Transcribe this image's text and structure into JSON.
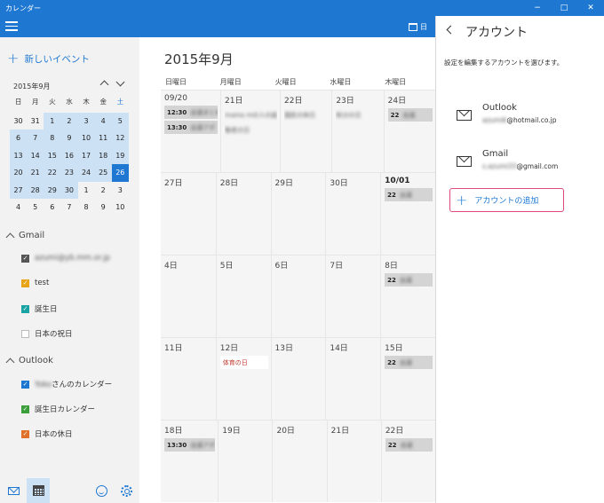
{
  "window": {
    "title": "カレンダー",
    "minimize": "−",
    "maximize": "□",
    "close": "✕"
  },
  "toolbar": {
    "today_label": "日"
  },
  "sidebar": {
    "new_event": "新しいイベント",
    "mini_month": "2015年9月",
    "dow": [
      "日",
      "月",
      "火",
      "水",
      "木",
      "金",
      "土"
    ],
    "weeks": [
      [
        "30",
        "31",
        "1",
        "2",
        "3",
        "4",
        "5"
      ],
      [
        "6",
        "7",
        "8",
        "9",
        "10",
        "11",
        "12"
      ],
      [
        "13",
        "14",
        "15",
        "16",
        "17",
        "18",
        "19"
      ],
      [
        "20",
        "21",
        "22",
        "23",
        "24",
        "25",
        "26"
      ],
      [
        "27",
        "28",
        "29",
        "30",
        "1",
        "2",
        "3"
      ],
      [
        "4",
        "5",
        "6",
        "7",
        "8",
        "9",
        "10"
      ]
    ],
    "groups": [
      {
        "name": "Gmail",
        "items": [
          {
            "label": "azumi@yb.mm.or.jp",
            "color": "#555555",
            "checked": true,
            "blurred": true
          },
          {
            "label": "test",
            "color": "#e8a317",
            "checked": true
          },
          {
            "label": "誕生日",
            "color": "#1aa3a3",
            "checked": true
          },
          {
            "label": "日本の祝日",
            "color": "#bbbbbb",
            "checked": false
          }
        ]
      },
      {
        "name": "Outlook",
        "items": [
          {
            "prefix": "Yoko",
            "label": "さんのカレンダー",
            "color": "#1e78d2",
            "checked": true
          },
          {
            "label": "誕生日カレンダー",
            "color": "#3a9e3a",
            "checked": true
          },
          {
            "label": "日本の休日",
            "color": "#e0702a",
            "checked": true
          }
        ]
      }
    ],
    "checkmark": "✓",
    "bottom_icons": [
      "mail-icon",
      "calendar-icon",
      "feedback-icon",
      "gear-icon"
    ]
  },
  "month": {
    "title": "2015年9月",
    "dow": [
      "日曜日",
      "月曜日",
      "火曜日",
      "水曜日",
      "木曜日"
    ],
    "weeks": [
      {
        "days": [
          {
            "num": "09/20",
            "events": [
              {
                "type": "grey",
                "time": "12:30",
                "text": "会議まとめ"
              },
              {
                "type": "grey",
                "time": "13:30",
                "text": "会議アポ"
              }
            ]
          },
          {
            "num": "21日",
            "events": [
              {
                "type": "text-green",
                "text": "mama mの人の誕"
              },
              {
                "type": "text-red",
                "text": "敬老の日"
              }
            ]
          },
          {
            "num": "22日",
            "events": [
              {
                "type": "text-red",
                "text": "国民の休日"
              }
            ]
          },
          {
            "num": "23日",
            "events": [
              {
                "type": "text-orange",
                "text": "秋分の日"
              }
            ]
          },
          {
            "num": "24日",
            "events": [
              {
                "type": "grey",
                "time": "22",
                "text": "会議"
              }
            ]
          }
        ]
      },
      {
        "days": [
          {
            "num": "27日",
            "events": []
          },
          {
            "num": "28日",
            "events": []
          },
          {
            "num": "29日",
            "events": []
          },
          {
            "num": "30日",
            "events": []
          },
          {
            "num": "10/01",
            "bold": true,
            "events": [
              {
                "type": "grey",
                "time": "22",
                "text": "会議"
              }
            ]
          }
        ]
      },
      {
        "days": [
          {
            "num": "4日",
            "events": []
          },
          {
            "num": "5日",
            "events": []
          },
          {
            "num": "6日",
            "events": []
          },
          {
            "num": "7日",
            "events": []
          },
          {
            "num": "8日",
            "events": [
              {
                "type": "grey",
                "time": "22",
                "text": "会議"
              }
            ]
          }
        ]
      },
      {
        "days": [
          {
            "num": "11日",
            "events": []
          },
          {
            "num": "12日",
            "events": [
              {
                "type": "white",
                "text": "体育の日"
              }
            ]
          },
          {
            "num": "13日",
            "events": []
          },
          {
            "num": "14日",
            "events": []
          },
          {
            "num": "15日",
            "events": [
              {
                "type": "grey",
                "time": "22",
                "text": "会議"
              }
            ]
          }
        ]
      },
      {
        "days": [
          {
            "num": "18日",
            "events": [
              {
                "type": "grey",
                "time": "13:30",
                "text": "会議アポ"
              }
            ]
          },
          {
            "num": "19日",
            "events": []
          },
          {
            "num": "20日",
            "events": []
          },
          {
            "num": "21日",
            "events": []
          },
          {
            "num": "22日",
            "events": [
              {
                "type": "grey",
                "time": "22",
                "text": "会議"
              }
            ]
          }
        ]
      }
    ]
  },
  "accounts_pane": {
    "title": "アカウント",
    "description": "設定を編集するアカウントを選びます。",
    "accounts": [
      {
        "name": "Outlook",
        "email_user": "azumi6",
        "email_domain": "@hotmail.co.jp"
      },
      {
        "name": "Gmail",
        "email_user": "s.azumi33",
        "email_domain": "@gmail.com"
      }
    ],
    "add_account": "アカウントの追加"
  }
}
